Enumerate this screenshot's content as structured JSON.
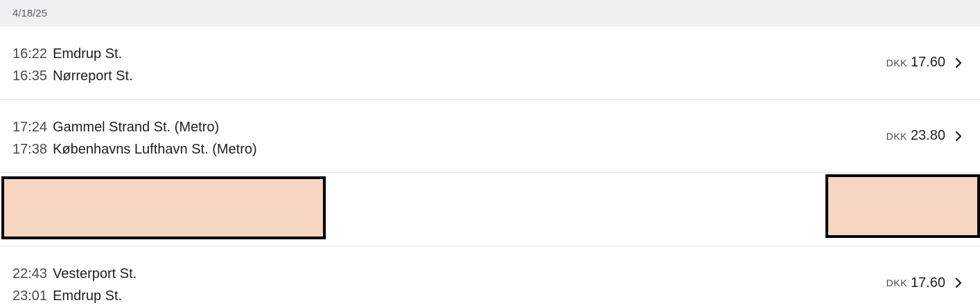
{
  "header": {
    "date": "4/18/25"
  },
  "trips": [
    {
      "departure": {
        "time": "16:22",
        "station": "Emdrup St."
      },
      "arrival": {
        "time": "16:35",
        "station": "Nørreport St."
      },
      "currency": "DKK",
      "price": "17.60",
      "chevron_icon": "chevron-right-icon"
    },
    {
      "departure": {
        "time": "17:24",
        "station": "Gammel Strand St. (Metro)"
      },
      "arrival": {
        "time": "17:38",
        "station": "Københavns Lufthavn St. (Metro)"
      },
      "currency": "DKK",
      "price": "23.80",
      "chevron_icon": "chevron-right-icon"
    },
    {
      "redacted": true
    },
    {
      "departure": {
        "time": "22:43",
        "station": "Vesterport St."
      },
      "arrival": {
        "time": "23:01",
        "station": "Emdrup St."
      },
      "currency": "DKK",
      "price": "17.60",
      "chevron_icon": "chevron-right-icon"
    }
  ],
  "colors": {
    "header_bg": "#eef0f4",
    "divider": "#e3e4e8",
    "redaction_fill": "#f6d5c3",
    "redaction_border": "#000000"
  }
}
